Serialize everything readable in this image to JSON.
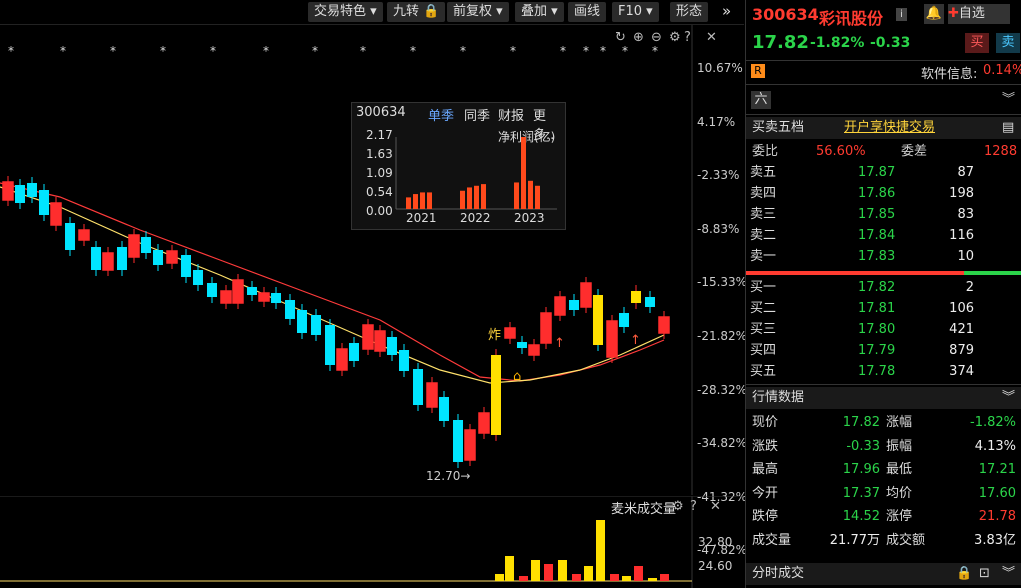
{
  "toolbar": {
    "items": [
      "交易特色",
      "九转",
      "前复权",
      "叠加",
      "画线",
      "F10",
      "形态"
    ],
    "arrow": "»"
  },
  "chart": {
    "y_labels": [
      "10.67%",
      "4.17%",
      "-2.33%",
      "-8.83%",
      "-15.33%",
      "-21.82%",
      "-28.32%",
      "-34.82%",
      "-41.32%",
      "-47.82%"
    ],
    "low_label": "12.70→",
    "tag_zha": "炸",
    "volume_title": "麦米成交量",
    "vol_labels": [
      "32.80",
      "24.60"
    ],
    "colors": {
      "up": "#ff2d2d",
      "down": "#00e5ff",
      "ma5": "#ffe16b",
      "ma10": "#ff3b3b"
    }
  },
  "popup": {
    "code": "300634",
    "tabs": [
      "单季",
      "同季",
      "财报",
      "更多.."
    ],
    "active_tab": "单季",
    "ticks": [
      "2.17",
      "1.63",
      "1.09",
      "0.54",
      "0.00"
    ],
    "metric": "净利润(亿)",
    "years": [
      "2021",
      "2022",
      "2023"
    ]
  },
  "header": {
    "code": "300634",
    "name": "彩讯股份",
    "price": "17.82",
    "change_pct": "-1.82%",
    "change": "-0.33",
    "buy_btn": "买",
    "sell_btn": "卖",
    "add_watch": "自选",
    "r_badge": "R",
    "sector_label": "软件信息:",
    "sector_pct": "0.14%",
    "six_badge": "六"
  },
  "orderbook": {
    "title": "买卖五档",
    "promo": "开户享快捷交易",
    "wei_bi_label": "委比",
    "wei_bi": "56.60%",
    "wei_cha_label": "委差",
    "wei_cha": "1288",
    "asks": [
      {
        "label": "卖五",
        "price": "17.87",
        "vol": "87"
      },
      {
        "label": "卖四",
        "price": "17.86",
        "vol": "198"
      },
      {
        "label": "卖三",
        "price": "17.85",
        "vol": "83"
      },
      {
        "label": "卖二",
        "price": "17.84",
        "vol": "116"
      },
      {
        "label": "卖一",
        "price": "17.83",
        "vol": "10"
      }
    ],
    "bids": [
      {
        "label": "买一",
        "price": "17.82",
        "vol": "2"
      },
      {
        "label": "买二",
        "price": "17.81",
        "vol": "106"
      },
      {
        "label": "买三",
        "price": "17.80",
        "vol": "421"
      },
      {
        "label": "买四",
        "price": "17.79",
        "vol": "879"
      },
      {
        "label": "买五",
        "price": "17.78",
        "vol": "374"
      }
    ]
  },
  "quote": {
    "title": "行情数据",
    "rows": [
      {
        "l1": "现价",
        "v1": "17.82",
        "c1": "green",
        "l2": "涨幅",
        "v2": "-1.82%",
        "c2": "green"
      },
      {
        "l1": "涨跌",
        "v1": "-0.33",
        "c1": "green",
        "l2": "振幅",
        "v2": "4.13%",
        "c2": "white"
      },
      {
        "l1": "最高",
        "v1": "17.96",
        "c1": "green",
        "l2": "最低",
        "v2": "17.21",
        "c2": "green"
      },
      {
        "l1": "今开",
        "v1": "17.37",
        "c1": "green",
        "l2": "均价",
        "v2": "17.60",
        "c2": "green"
      },
      {
        "l1": "跌停",
        "v1": "14.52",
        "c1": "green",
        "l2": "涨停",
        "v2": "21.78",
        "c2": "red"
      },
      {
        "l1": "成交量",
        "v1": "21.77万",
        "c1": "white",
        "l2": "成交额",
        "v2": "3.83亿",
        "c2": "white"
      }
    ],
    "footer": "分时成交"
  }
}
